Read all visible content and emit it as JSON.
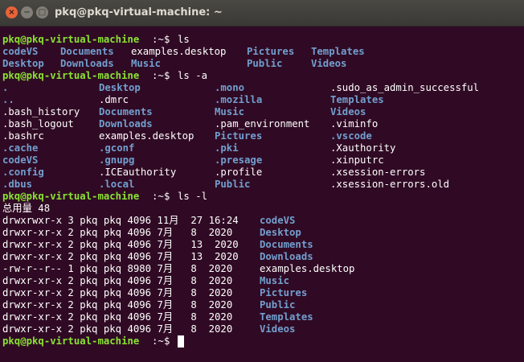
{
  "window": {
    "title": "pkq@pkq-virtual-machine: ~",
    "buttons": {
      "close": "×",
      "minimize": "−",
      "maximize": "□"
    }
  },
  "prompt": {
    "user_host": "pkq@pkq-virtual-machine",
    "path": ":~",
    "symbol": "$ "
  },
  "commands": {
    "ls": "ls",
    "ls_a": "ls -a",
    "ls_l": "ls -l"
  },
  "ls_output": [
    [
      "codeVS",
      "Documents",
      "examples.desktop",
      "Pictures",
      "Templates"
    ],
    [
      "Desktop",
      "Downloads",
      "Music",
      "Public",
      "Videos"
    ]
  ],
  "ls_a_output": [
    [
      ".",
      "Desktop",
      ".mono",
      ".sudo_as_admin_successful"
    ],
    [
      "..",
      ".dmrc",
      ".mozilla",
      "Templates"
    ],
    [
      ".bash_history",
      "Documents",
      "Music",
      "Videos"
    ],
    [
      ".bash_logout",
      "Downloads",
      ".pam_environment",
      ".viminfo"
    ],
    [
      ".bashrc",
      "examples.desktop",
      "Pictures",
      ".vscode"
    ],
    [
      ".cache",
      ".gconf",
      ".pki",
      ".Xauthority"
    ],
    [
      "codeVS",
      ".gnupg",
      ".presage",
      ".xinputrc"
    ],
    [
      ".config",
      ".ICEauthority",
      ".profile",
      ".xsession-errors"
    ],
    [
      ".dbus",
      ".local",
      "Public",
      ".xsession-errors.old"
    ]
  ],
  "ls_l_total": "总用量 48",
  "ls_l_output": [
    {
      "perm": "drwxrwxr-x 3 pkq pkq 4096 11月  27 16:24 ",
      "name": "codeVS"
    },
    {
      "perm": "drwxr-xr-x 2 pkq pkq 4096 7月   8  2020 ",
      "name": "Desktop"
    },
    {
      "perm": "drwxr-xr-x 2 pkq pkq 4096 7月   13  2020 ",
      "name": "Documents"
    },
    {
      "perm": "drwxr-xr-x 2 pkq pkq 4096 7月   13  2020 ",
      "name": "Downloads"
    },
    {
      "perm": "-rw-r--r-- 1 pkq pkq 8980 7月   8  2020 ",
      "name": "examples.desktop"
    },
    {
      "perm": "drwxr-xr-x 2 pkq pkq 4096 7月   8  2020 ",
      "name": "Music"
    },
    {
      "perm": "drwxr-xr-x 2 pkq pkq 4096 7月   8  2020 ",
      "name": "Pictures"
    },
    {
      "perm": "drwxr-xr-x 2 pkq pkq 4096 7月   8  2020 ",
      "name": "Public"
    },
    {
      "perm": "drwxr-xr-x 2 pkq pkq 4096 7月   8  2020 ",
      "name": "Templates"
    },
    {
      "perm": "drwxr-xr-x 2 pkq pkq 4096 7月   8  2020 ",
      "name": "Videos"
    }
  ],
  "colors": {
    "background": "#300a24",
    "prompt_host": "#8ae234",
    "directory": "#729fcf",
    "text": "#ffffff"
  }
}
